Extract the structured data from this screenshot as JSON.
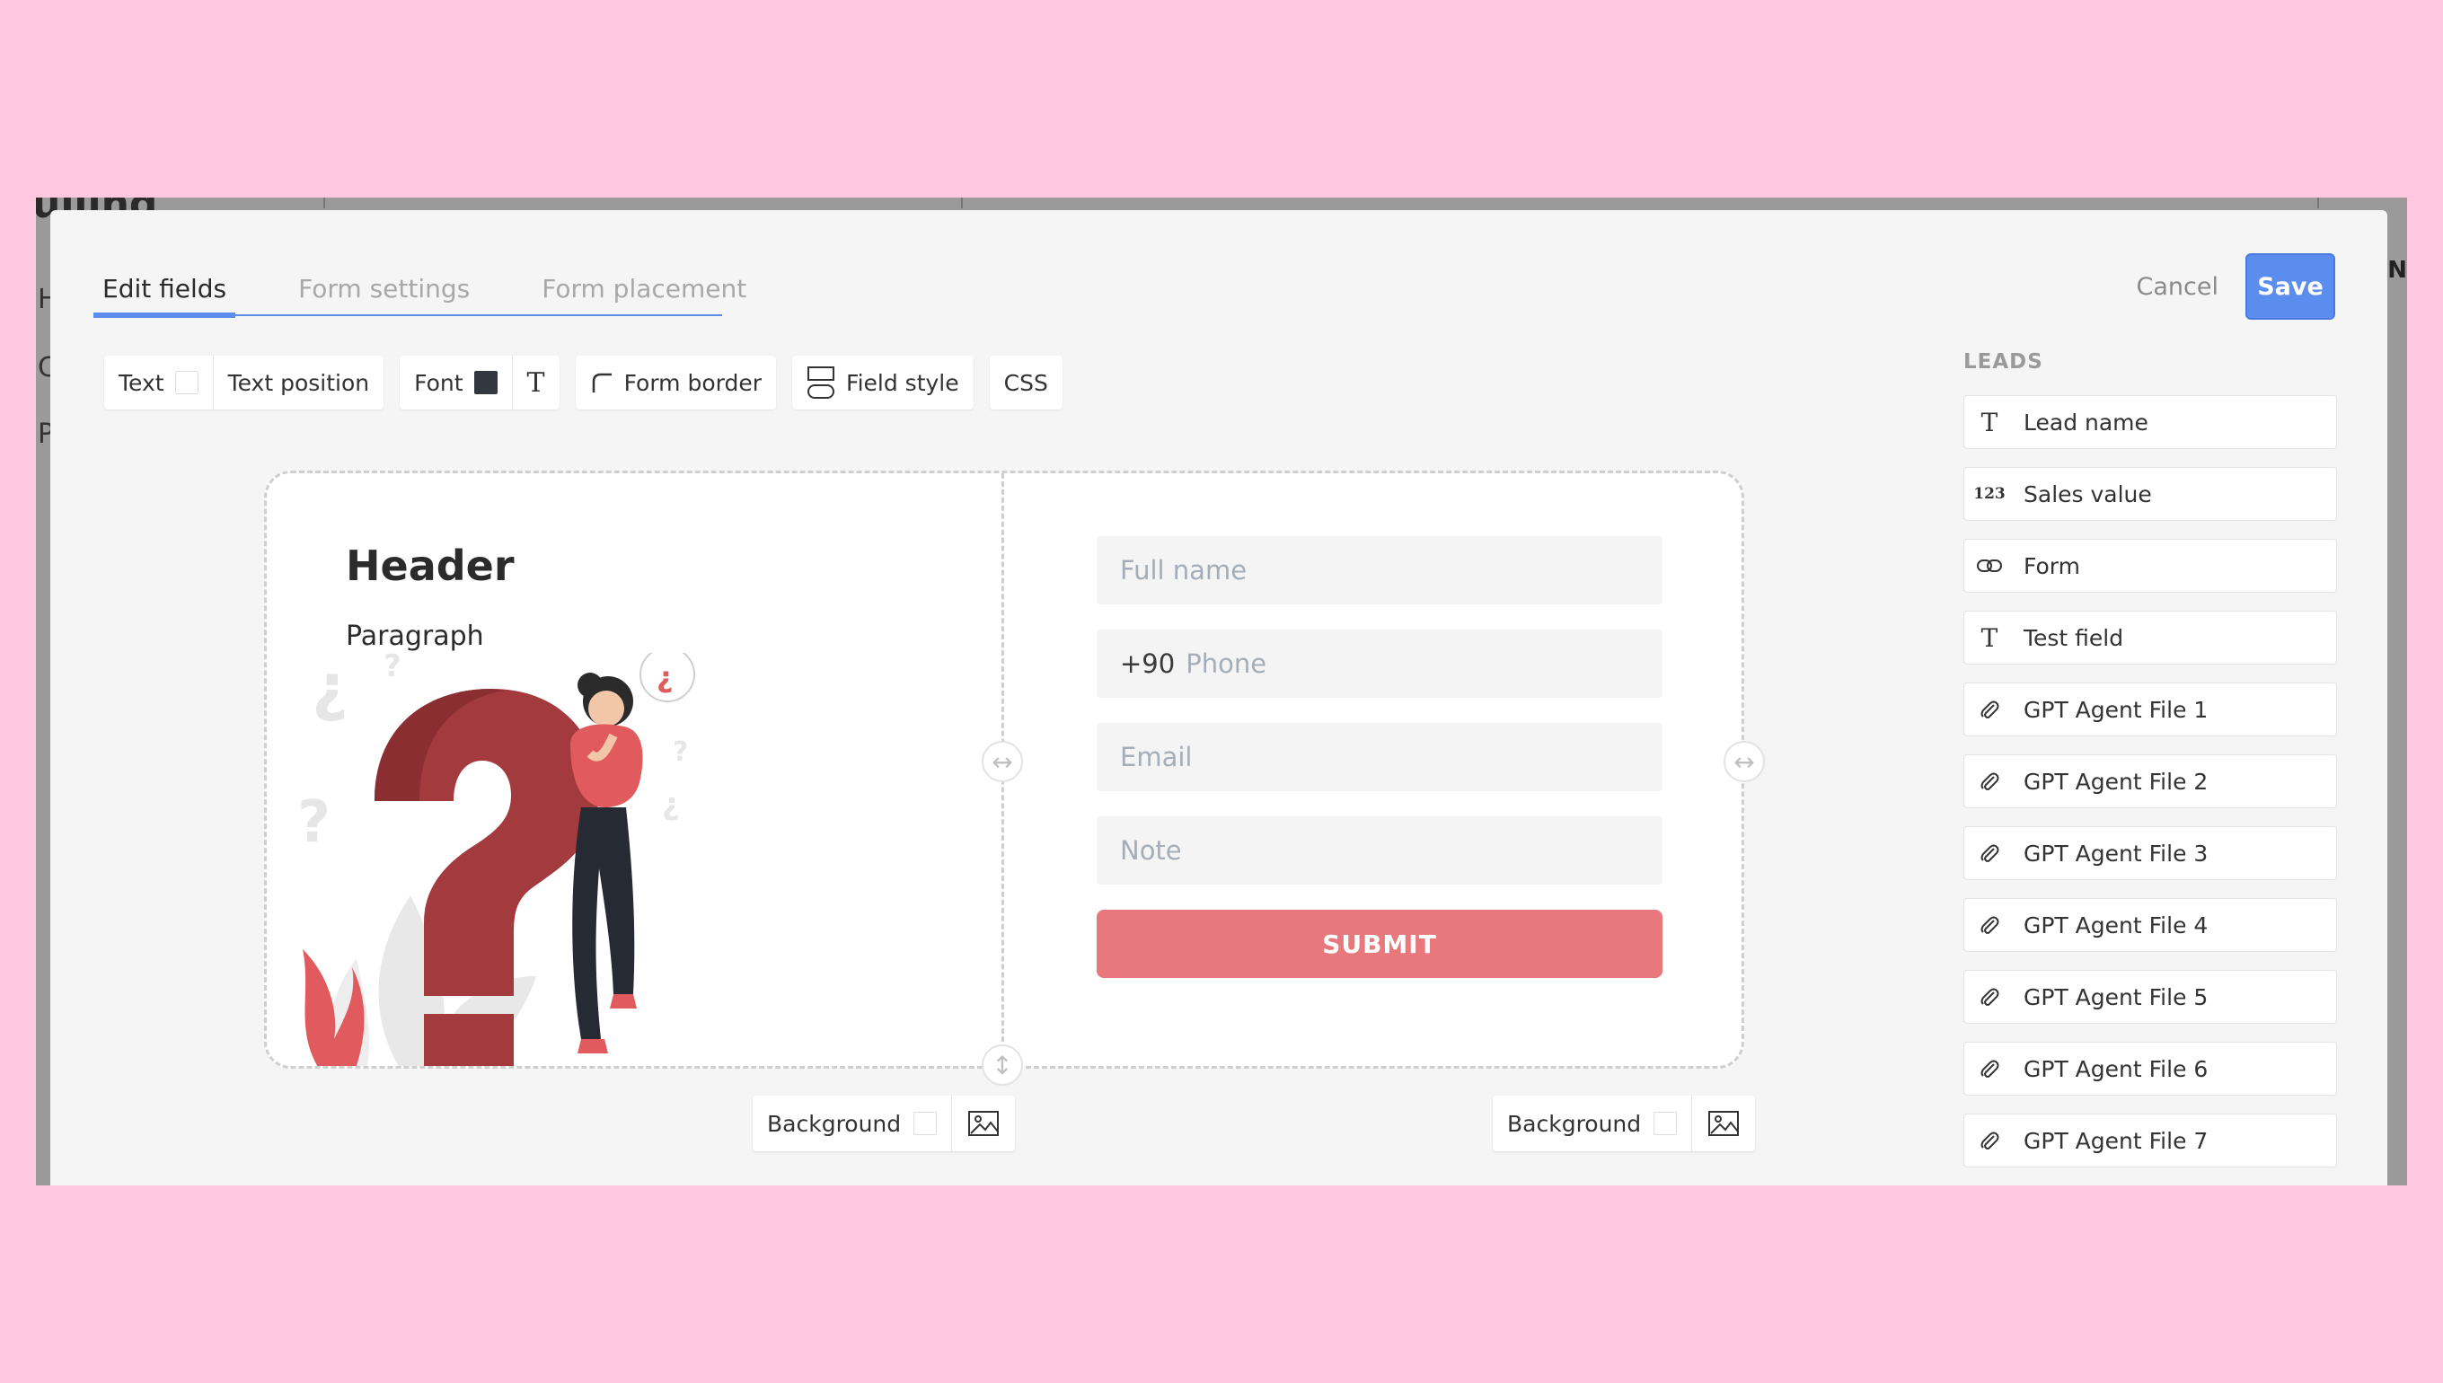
{
  "background_app": {
    "title_fragment": "ulling",
    "side_letters": [
      "H",
      "C",
      "P"
    ],
    "right_letter": "N"
  },
  "tabs": [
    {
      "label": "Edit fields",
      "active": true
    },
    {
      "label": "Form settings",
      "active": false
    },
    {
      "label": "Form placement",
      "active": false
    }
  ],
  "actions": {
    "cancel": "Cancel",
    "save": "Save"
  },
  "toolbar": {
    "text": "Text",
    "text_position": "Text position",
    "font": "Font",
    "form_border": "Form border",
    "field_style": "Field style",
    "css": "CSS"
  },
  "form": {
    "header": "Header",
    "paragraph": "Paragraph",
    "fields": [
      {
        "placeholder": "Full name"
      },
      {
        "prefix": "+90",
        "placeholder": "Phone"
      },
      {
        "placeholder": "Email"
      },
      {
        "placeholder": "Note"
      }
    ],
    "submit": "SUBMIT",
    "submit_color": "#e8787c"
  },
  "background_controls": {
    "left_label": "Background",
    "right_label": "Background"
  },
  "leads": {
    "title": "LEADS",
    "items": [
      {
        "icon": "text-icon",
        "label": "Lead name"
      },
      {
        "icon": "number-icon",
        "label": "Sales value"
      },
      {
        "icon": "link-icon",
        "label": "Form"
      },
      {
        "icon": "text-icon",
        "label": "Test field"
      },
      {
        "icon": "paperclip-icon",
        "label": "GPT Agent File 1"
      },
      {
        "icon": "paperclip-icon",
        "label": "GPT Agent File 2"
      },
      {
        "icon": "paperclip-icon",
        "label": "GPT Agent File 3"
      },
      {
        "icon": "paperclip-icon",
        "label": "GPT Agent File 4"
      },
      {
        "icon": "paperclip-icon",
        "label": "GPT Agent File 5"
      },
      {
        "icon": "paperclip-icon",
        "label": "GPT Agent File 6"
      },
      {
        "icon": "paperclip-icon",
        "label": "GPT Agent File 7"
      }
    ]
  },
  "colors": {
    "accent": "#5b8def",
    "page_background": "#ffc8e0"
  }
}
